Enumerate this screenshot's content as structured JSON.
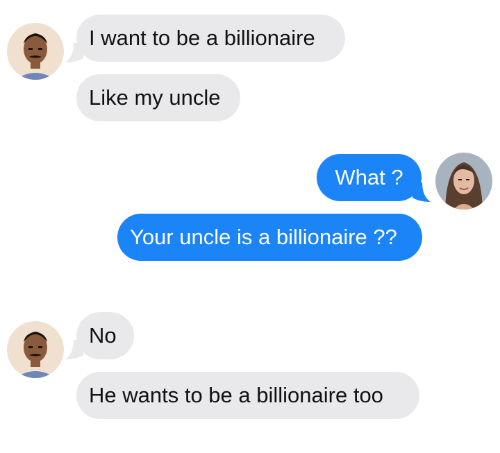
{
  "thread": {
    "messages": [
      {
        "sender": "man",
        "side": "left",
        "text": "I want to be a billionaire"
      },
      {
        "sender": "man",
        "side": "left",
        "text": "Like my uncle"
      },
      {
        "sender": "woman",
        "side": "right",
        "text": "What ?"
      },
      {
        "sender": "woman",
        "side": "right",
        "text": "Your uncle is a billionaire ??"
      },
      {
        "sender": "man",
        "side": "left",
        "text": "No"
      },
      {
        "sender": "man",
        "side": "left",
        "text": "He wants to be a billionaire too"
      }
    ],
    "colors": {
      "received_bubble": "#e9e9eb",
      "received_text": "#111111",
      "sent_bubble": "#1b84f7",
      "sent_text": "#ffffff"
    },
    "avatars": {
      "man": "man-avatar-icon",
      "woman": "woman-avatar-icon"
    }
  }
}
